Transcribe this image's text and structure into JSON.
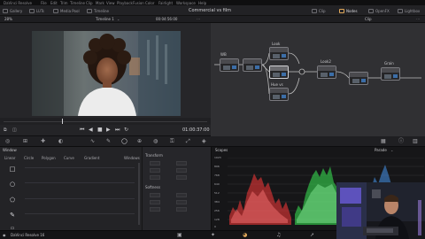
{
  "menubar": {
    "app": "DaVinci Resolve",
    "items": [
      "File",
      "Edit",
      "Trim",
      "Timeline",
      "Clip",
      "Mark",
      "View",
      "Playback",
      "Fusion",
      "Color",
      "Fairlight",
      "Workspace",
      "Help"
    ]
  },
  "toolbar": {
    "left": [
      "Gallery",
      "LUTs",
      "Media Pool",
      "Timeline"
    ],
    "project_title": "Commercial vs film",
    "right": [
      "Clip",
      "Nodes",
      "OpenFX",
      "Lightbox"
    ]
  },
  "viewer": {
    "zoom": "28%",
    "timeline_name": "Timeline 1",
    "source_tc": "00:04:56:00",
    "timecode": "01:00:37:00"
  },
  "nodes": {
    "header": "Clip",
    "labels": [
      "WB",
      "Look",
      "Hue vs",
      "Look2",
      "Grain"
    ],
    "numbers": [
      "01",
      "02",
      "03",
      "04",
      "05",
      "06",
      "07"
    ]
  },
  "window_panel": {
    "title": "Window",
    "tools": [
      "Linear",
      "Circle",
      "Polygon",
      "Curve",
      "Gradient"
    ],
    "windows_label": "Windows",
    "transform": "Transform",
    "softness": "Softness"
  },
  "scopes": {
    "title": "Scopes",
    "mode": "Parade",
    "scale": [
      "1023",
      "896",
      "768",
      "640",
      "512",
      "384",
      "256",
      "128",
      "0"
    ]
  },
  "bottombar": {
    "app": "DaVinci Resolve 16"
  },
  "colors": {
    "accent": "#e0a85a",
    "node_link": "#bdbdbd",
    "red_channel": "#ff3b3b",
    "green_channel": "#3bff5a",
    "blue_channel": "#4aa0ff"
  }
}
